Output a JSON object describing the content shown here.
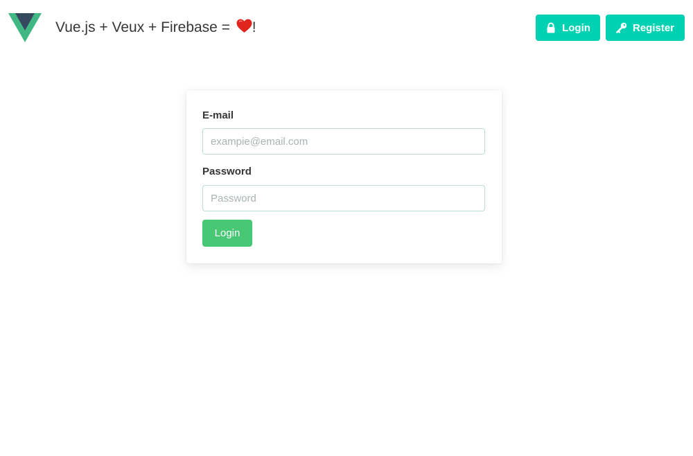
{
  "navbar": {
    "logo_icon": "vue-logo-icon",
    "title_prefix": "Vue.js + Veux + Firebase = ",
    "title_suffix": "!",
    "heart_icon": "heart-icon",
    "login_label": "Login",
    "login_icon": "lock-icon",
    "register_label": "Register",
    "register_icon": "key-icon"
  },
  "form": {
    "email_label": "E-mail",
    "email_placeholder": "exampie@email.com",
    "email_value": "",
    "password_label": "Password",
    "password_placeholder": "Password",
    "password_value": "",
    "submit_label": "Login"
  },
  "colors": {
    "primary": "#00d1b2",
    "success": "#48c774",
    "vue_green": "#41b883",
    "vue_dark": "#35495e",
    "heart": "#e0241e",
    "text": "#363636"
  }
}
